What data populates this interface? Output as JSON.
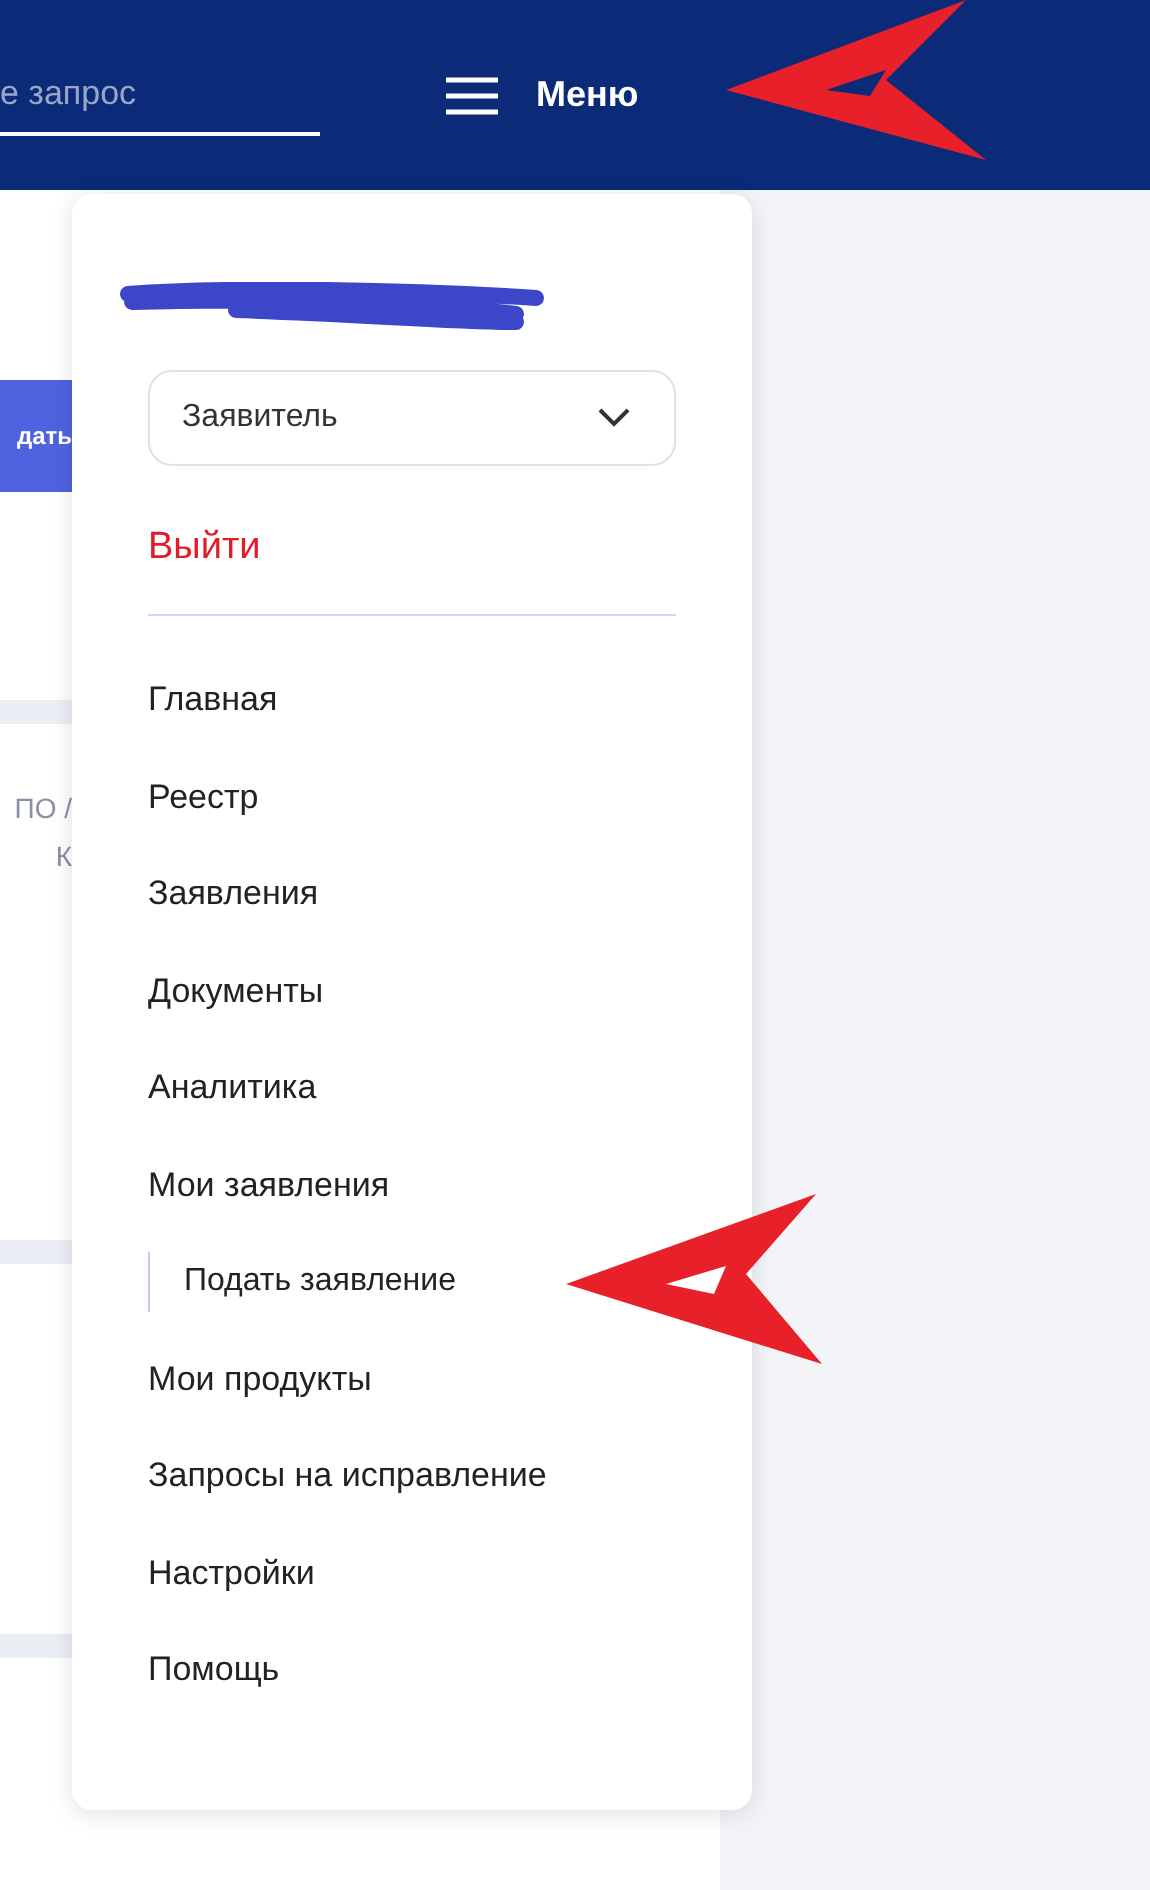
{
  "header": {
    "search": {
      "placeholder": "е запрос"
    },
    "menu_button": "Меню"
  },
  "background": {
    "button": "дать",
    "column_label": [
      "ПО /",
      "К"
    ]
  },
  "menu": {
    "role_select": {
      "value": "Заявитель"
    },
    "logout": "Выйти",
    "items": [
      {
        "label": "Главная"
      },
      {
        "label": "Реестр"
      },
      {
        "label": "Заявления"
      },
      {
        "label": "Документы"
      },
      {
        "label": "Аналитика"
      },
      {
        "label": "Мои заявления",
        "children": [
          {
            "label": "Подать заявление"
          }
        ]
      },
      {
        "label": "Мои продукты"
      },
      {
        "label": "Запросы на исправление"
      },
      {
        "label": "Настройки"
      },
      {
        "label": "Помощь"
      }
    ]
  }
}
